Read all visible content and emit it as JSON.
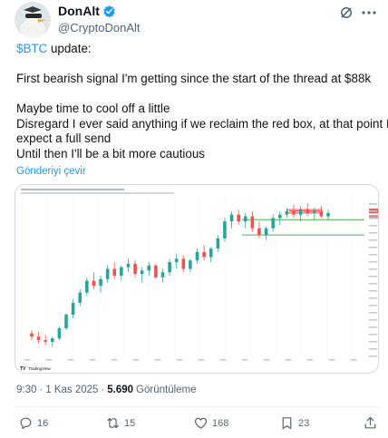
{
  "author": {
    "name": "DonAlt",
    "handle": "@CryptoDonAlt",
    "verified_color": "#1d9bf0"
  },
  "tweet": {
    "cashtag": "$BTC",
    "line1_rest": " update:",
    "line2": "First bearish signal I'm getting since the start of the thread at $88k",
    "line3": "Maybe time to cool off a little",
    "line4": "Disregard I ever said anything if we reclaim the red box, at that point I'd",
    "line5": "expect a full send",
    "line6": "Until then I'll be a bit more cautious",
    "translate_link": "Gönderiyi çevir"
  },
  "chart": {
    "watermark": "TradingView",
    "candle_up_color": "#26a69a",
    "candle_down_color": "#ef5350",
    "chart_data": {
      "type": "candlestick",
      "ohlc": [
        [
          22,
          24,
          18,
          20
        ],
        [
          20,
          23,
          16,
          18
        ],
        [
          18,
          21,
          15,
          17
        ],
        [
          17,
          20,
          14,
          19
        ],
        [
          19,
          26,
          18,
          25
        ],
        [
          25,
          34,
          24,
          33
        ],
        [
          33,
          42,
          31,
          40
        ],
        [
          40,
          48,
          38,
          46
        ],
        [
          46,
          55,
          44,
          53
        ],
        [
          53,
          58,
          48,
          50
        ],
        [
          50,
          56,
          46,
          54
        ],
        [
          54,
          62,
          52,
          60
        ],
        [
          60,
          64,
          54,
          56
        ],
        [
          56,
          62,
          53,
          61
        ],
        [
          61,
          66,
          58,
          63
        ],
        [
          63,
          65,
          55,
          57
        ],
        [
          57,
          61,
          52,
          59
        ],
        [
          59,
          64,
          56,
          62
        ],
        [
          62,
          63,
          54,
          55
        ],
        [
          55,
          60,
          52,
          58
        ],
        [
          58,
          66,
          56,
          64
        ],
        [
          64,
          69,
          60,
          66
        ],
        [
          66,
          68,
          58,
          60
        ],
        [
          60,
          66,
          58,
          65
        ],
        [
          65,
          72,
          63,
          70
        ],
        [
          70,
          74,
          65,
          67
        ],
        [
          67,
          73,
          64,
          72
        ],
        [
          72,
          80,
          70,
          78
        ],
        [
          78,
          90,
          76,
          88
        ],
        [
          88,
          94,
          84,
          92
        ],
        [
          92,
          95,
          86,
          88
        ],
        [
          88,
          93,
          84,
          91
        ],
        [
          91,
          94,
          82,
          84
        ],
        [
          84,
          88,
          78,
          80
        ],
        [
          80,
          85,
          77,
          84
        ],
        [
          84,
          92,
          82,
          90
        ],
        [
          90,
          94,
          86,
          92
        ],
        [
          92,
          96,
          90,
          94
        ],
        [
          94,
          98,
          90,
          92
        ],
        [
          92,
          97,
          88,
          95
        ],
        [
          95,
          99,
          91,
          93
        ],
        [
          93,
          96,
          89,
          94
        ],
        [
          94,
          97,
          90,
          91
        ],
        [
          91,
          95,
          89,
          93
        ]
      ],
      "red_box_range": [
        93,
        95
      ],
      "green_levels": [
        89,
        80
      ],
      "current_price_tag_color": "#ef5350"
    }
  },
  "meta": {
    "time": "9:30",
    "separator": "·",
    "date": "1 Kas 2025",
    "separator2": "·",
    "views": "5.690",
    "views_label": "Görüntüleme"
  },
  "actions": {
    "replies": "16",
    "reposts": "15",
    "likes": "168",
    "bookmarks": "23"
  }
}
